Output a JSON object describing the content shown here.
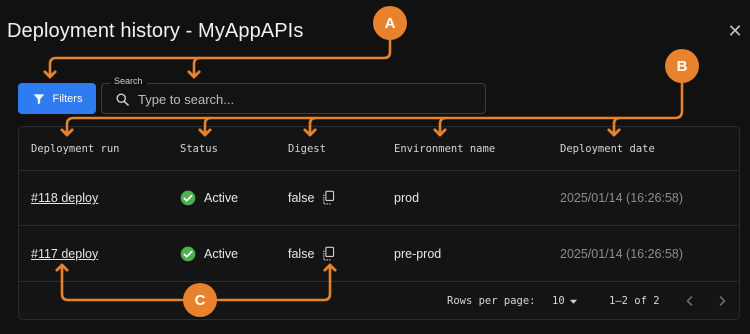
{
  "dialog": {
    "title": "Deployment history - MyAppAPIs",
    "close_icon": "close-icon"
  },
  "toolbar": {
    "filters_label": "Filters",
    "filters_icon": "filter-icon",
    "search_label": "Search",
    "search_placeholder": "Type to search...",
    "search_value": ""
  },
  "table": {
    "columns": [
      "Deployment run",
      "Status",
      "Digest",
      "Environment name",
      "Deployment date"
    ],
    "rows": [
      {
        "run": "#118 deploy",
        "status": "Active",
        "digest": "false",
        "environment": "prod",
        "date": "2025/01/14 (16:26:58)"
      },
      {
        "run": "#117 deploy",
        "status": "Active",
        "digest": "false",
        "environment": "pre-prod",
        "date": "2025/01/14 (16:26:58)"
      }
    ]
  },
  "pagination": {
    "rows_per_page_label": "Rows per page:",
    "rows_per_page_value": "10",
    "range": "1–2 of 2"
  },
  "annotations": {
    "a": "A",
    "b": "B",
    "c": "C"
  },
  "colors": {
    "accent": "#2f7bf0",
    "annotation": "#e8822d",
    "status_active": "#4caf50"
  }
}
